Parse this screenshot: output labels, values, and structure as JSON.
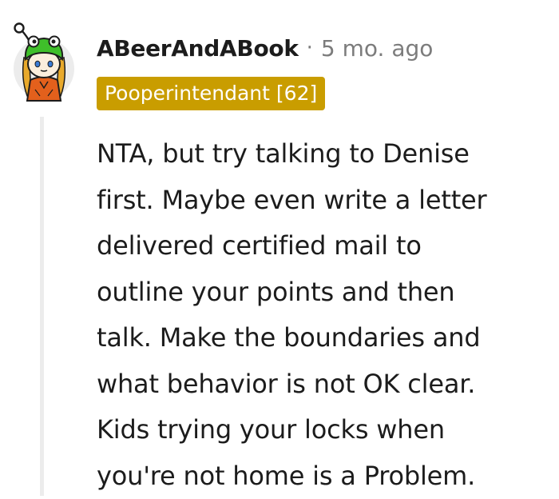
{
  "comment": {
    "author": "ABeerAndABook",
    "separator": "·",
    "timestamp": "5 mo. ago",
    "flair": "Pooperintendant [62]",
    "flair_color": "#c99d00",
    "body_lines": [
      "NTA, but try talking to Denise",
      "first. Maybe even write a letter",
      "delivered certified mail to",
      "outline your points and then",
      "talk. Make the boundaries and",
      "what behavior is not OK clear.",
      "Kids trying your locks when",
      "you're not home is a Problem."
    ]
  },
  "avatar": {
    "icon": "snoo-avatar-green-hat",
    "hat_color": "#3fbf2a",
    "body_color": "#e3601c",
    "hair_color": "#e8a92b"
  }
}
